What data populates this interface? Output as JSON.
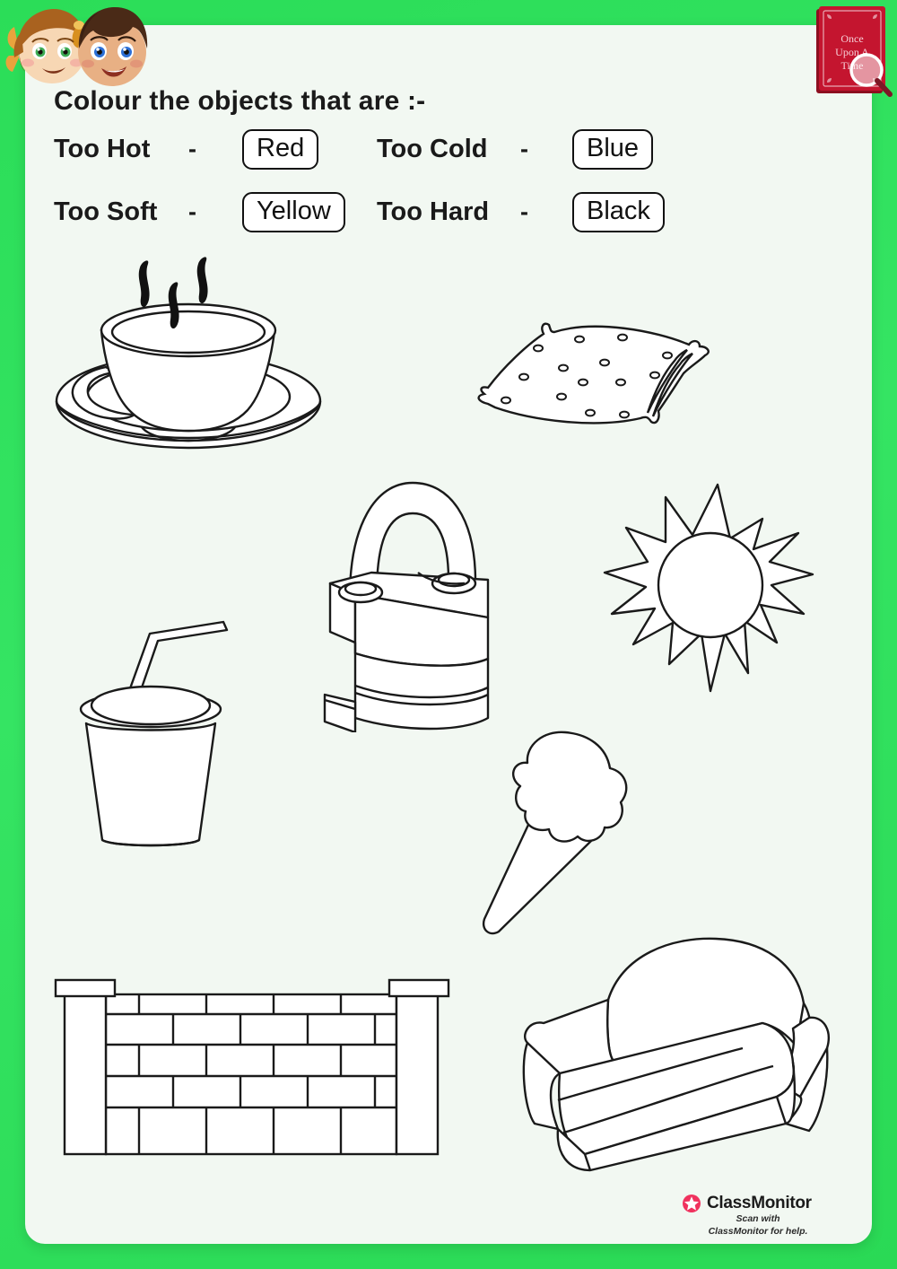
{
  "page": {
    "background_color": "#33e060",
    "sheet_color": "#f2f8f2",
    "ink_color": "#111111"
  },
  "header": {
    "title": "Colour the objects that are :-",
    "rules": [
      {
        "label": "Too Hot",
        "dash": "-",
        "colour": "Red"
      },
      {
        "label": "Too Cold",
        "dash": "-",
        "colour": "Blue"
      },
      {
        "label": "Too Soft",
        "dash": "-",
        "colour": "Yellow"
      },
      {
        "label": "Too Hard",
        "dash": "-",
        "colour": "Black"
      }
    ]
  },
  "book_badge": {
    "line1": "Once",
    "line2": "Upon A",
    "line3": "Time",
    "cover_color": "#c4152f"
  },
  "objects": [
    {
      "name": "teacup",
      "label": "Cup of hot tea with steam"
    },
    {
      "name": "pillow",
      "label": "Polka dot pillow"
    },
    {
      "name": "padlock",
      "label": "Metal padlock"
    },
    {
      "name": "sun",
      "label": "Sun with rays"
    },
    {
      "name": "drink-cup",
      "label": "Cold drink cup with straw"
    },
    {
      "name": "ice-cream",
      "label": "Ice cream cone"
    },
    {
      "name": "brick-wall",
      "label": "Brick wall with pillars"
    },
    {
      "name": "sofa",
      "label": "Sofa armchair"
    }
  ],
  "footer": {
    "brand": "ClassMonitor",
    "sub_line1": "Scan with",
    "sub_line2": "ClassMonitor for help.",
    "accent_color": "#f0325e"
  }
}
